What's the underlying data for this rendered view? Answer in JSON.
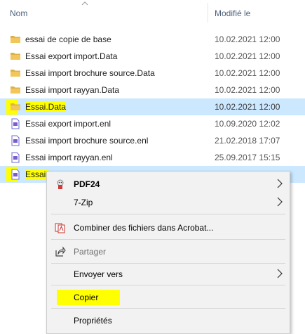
{
  "header": {
    "name_label": "Nom",
    "date_label": "Modifié le"
  },
  "rows": [
    {
      "name": "essai de copie de base",
      "date": "10.02.2021 12:00"
    },
    {
      "name": "Essai export import.Data",
      "date": "10.02.2021 12:00"
    },
    {
      "name": "Essai import brochure source.Data",
      "date": "10.02.2021 12:00"
    },
    {
      "name": "Essai import rayyan.Data",
      "date": "10.02.2021 12:00"
    },
    {
      "name": "Essai.Data",
      "date": "10.02.2021 12:00"
    },
    {
      "name": "Essai export import.enl",
      "date": "10.09.2020 12:02"
    },
    {
      "name": "Essai import brochure source.enl",
      "date": "21.02.2018 17:07"
    },
    {
      "name": "Essai import rayyan.enl",
      "date": "25.09.2017 15:15"
    },
    {
      "name": "Essai.",
      "date": ""
    }
  ],
  "context_menu": {
    "pdf24": "PDF24",
    "sevenzip": "7-Zip",
    "acrobat": "Combiner des fichiers dans Acrobat...",
    "share": "Partager",
    "send_to": "Envoyer vers",
    "copy": "Copier",
    "properties": "Propriétés"
  },
  "colors": {
    "selection": "#cce8ff",
    "highlight": "#ffff00",
    "folder": "#dcb14a",
    "menu_bg": "#f2f2f2"
  },
  "icons": {
    "folder": "folder-icon",
    "enl_file": "enl-file-icon",
    "pdf24": "pdf24-icon",
    "acrobat": "acrobat-icon",
    "share": "share-icon",
    "submenu": "chevron-right-icon"
  }
}
